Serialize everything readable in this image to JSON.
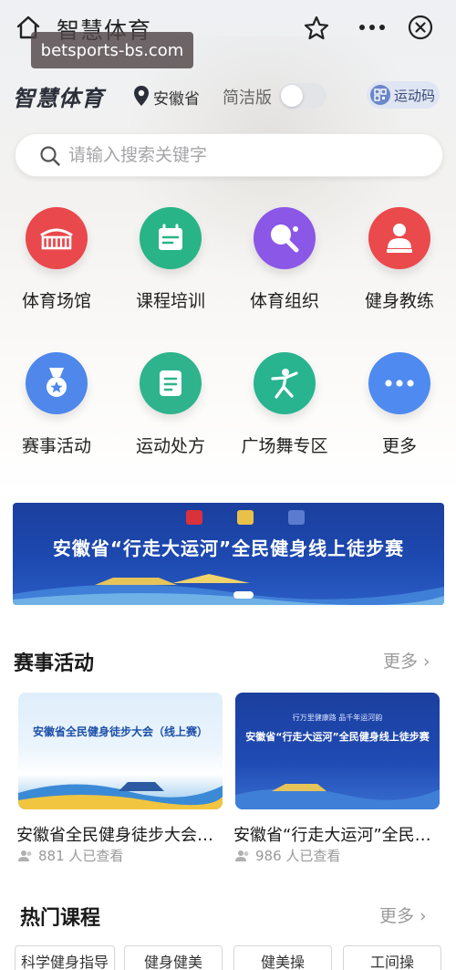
{
  "titlebar": {
    "title": "智慧体育"
  },
  "watermark": {
    "text": "betsports-bs.com"
  },
  "brand": {
    "name": "智慧体育",
    "location": "安徽省",
    "simple_label": "简洁版",
    "simple_on": false,
    "sport_code_label": "运动码"
  },
  "search": {
    "placeholder": "请输入搜索关键字",
    "value": ""
  },
  "grid": [
    {
      "label": "体育场馆",
      "icon": "stadium-icon",
      "color": "#e9484c"
    },
    {
      "label": "课程培训",
      "icon": "calendar-icon",
      "color": "#28b487"
    },
    {
      "label": "体育组织",
      "icon": "ping-pong-icon",
      "color": "#8b57e6"
    },
    {
      "label": "健身教练",
      "icon": "coach-icon",
      "color": "#ea4a4c"
    },
    {
      "label": "赛事活动",
      "icon": "medal-icon",
      "color": "#4f87ea"
    },
    {
      "label": "运动处方",
      "icon": "prescription-icon",
      "color": "#2fb38d"
    },
    {
      "label": "广场舞专区",
      "icon": "dancer-icon",
      "color": "#27b48f"
    },
    {
      "label": "更多",
      "icon": "more-dots-icon",
      "color": "#4e8af0"
    }
  ],
  "banner": {
    "title": "安徽省“行走大运河”全民健身线上徒步赛"
  },
  "events": {
    "title": "赛事活动",
    "more": "更多",
    "cards": [
      {
        "title": "安徽省全民健身徒步大会（线上赛）",
        "image_title": "安徽省全民健身徒步大会（线上赛）",
        "views": "881 人已查看"
      },
      {
        "title": "安徽省“行走大运河”全民健身线上徒步赛",
        "image_title": "安徽省“行走大运河”全民健身线上徒步赛",
        "image_sub": "行万里健康路  品千年运河韵",
        "views": "986 人已查看"
      }
    ]
  },
  "courses": {
    "title": "热门课程",
    "more": "更多",
    "tags": [
      "科学健身指导",
      "健身健美",
      "健美操",
      "工间操"
    ]
  },
  "colors": {
    "accent": "#1d49b0",
    "muted": "#9a9a9a"
  }
}
